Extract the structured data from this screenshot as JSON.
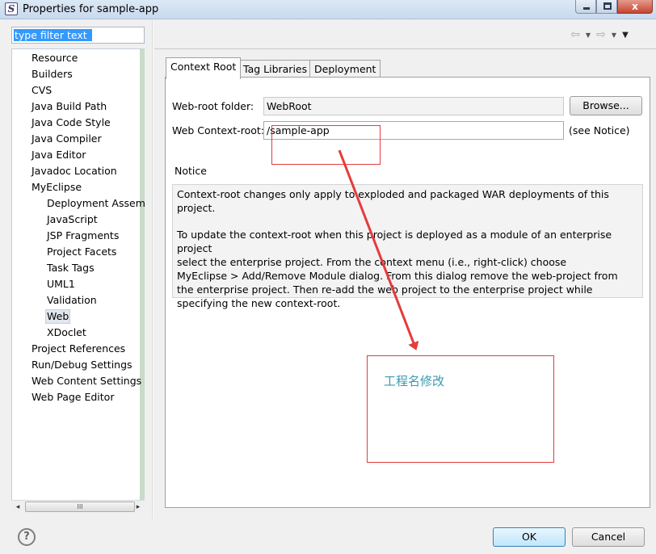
{
  "window": {
    "app_icon": "S",
    "title": "Properties for sample-app",
    "minimize_icon": "minimize-icon",
    "maximize_icon": "maximize-icon",
    "close_glyph": "x"
  },
  "filter": {
    "value": "type filter text"
  },
  "tree": {
    "items": [
      {
        "label": "Resource",
        "level": 0
      },
      {
        "label": "Builders",
        "level": 0
      },
      {
        "label": "CVS",
        "level": 0
      },
      {
        "label": "Java Build Path",
        "level": 0
      },
      {
        "label": "Java Code Style",
        "level": 0
      },
      {
        "label": "Java Compiler",
        "level": 0
      },
      {
        "label": "Java Editor",
        "level": 0
      },
      {
        "label": "Javadoc Location",
        "level": 0
      },
      {
        "label": "MyEclipse",
        "level": 0
      },
      {
        "label": "Deployment Assembly",
        "level": 1
      },
      {
        "label": "JavaScript",
        "level": 1
      },
      {
        "label": "JSP Fragments",
        "level": 1
      },
      {
        "label": "Project Facets",
        "level": 1
      },
      {
        "label": "Task Tags",
        "level": 1
      },
      {
        "label": "UML1",
        "level": 1
      },
      {
        "label": "Validation",
        "level": 1
      },
      {
        "label": "Web",
        "level": 1,
        "selected": true
      },
      {
        "label": "XDoclet",
        "level": 1
      },
      {
        "label": "Project References",
        "level": 0
      },
      {
        "label": "Run/Debug Settings",
        "level": 0
      },
      {
        "label": "Web Content Settings",
        "level": 0
      },
      {
        "label": "Web Page Editor",
        "level": 0
      }
    ],
    "scroll_left": "◂",
    "scroll_right": "▸",
    "scroll_grip": "III"
  },
  "nav": {
    "back_glyph": "⇦",
    "forward_glyph": "⇨",
    "dropdown_glyph": "▼",
    "menu_glyph": "▼"
  },
  "tabs": [
    {
      "label": "Context Root",
      "active": true
    },
    {
      "label": "Tag Libraries",
      "active": false
    },
    {
      "label": "Deployment",
      "active": false
    }
  ],
  "form": {
    "webroot_label": "Web-root folder:",
    "webroot_value": "WebRoot",
    "browse_label": "Browse...",
    "context_label": "Web Context-root:",
    "context_value": "/sample-app",
    "see_notice": "(see Notice)"
  },
  "notice": {
    "heading": "Notice",
    "para1": "Context-root changes only apply to exploded and packaged WAR deployments of this project.",
    "para2": "To update the context-root when this project is deployed as a module of an enterprise project\nselect the enterprise project. From the context menu (i.e., right-click) choose\nMyEclipse > Add/Remove Module dialog. From this dialog remove the web-project from\nthe enterprise project. Then re-add the web project to the enterprise project while\nspecifying the new context-root."
  },
  "annotation": {
    "text": "工程名修改",
    "color": "#e53b3b"
  },
  "footer": {
    "help_glyph": "?",
    "ok_label": "OK",
    "cancel_label": "Cancel"
  }
}
